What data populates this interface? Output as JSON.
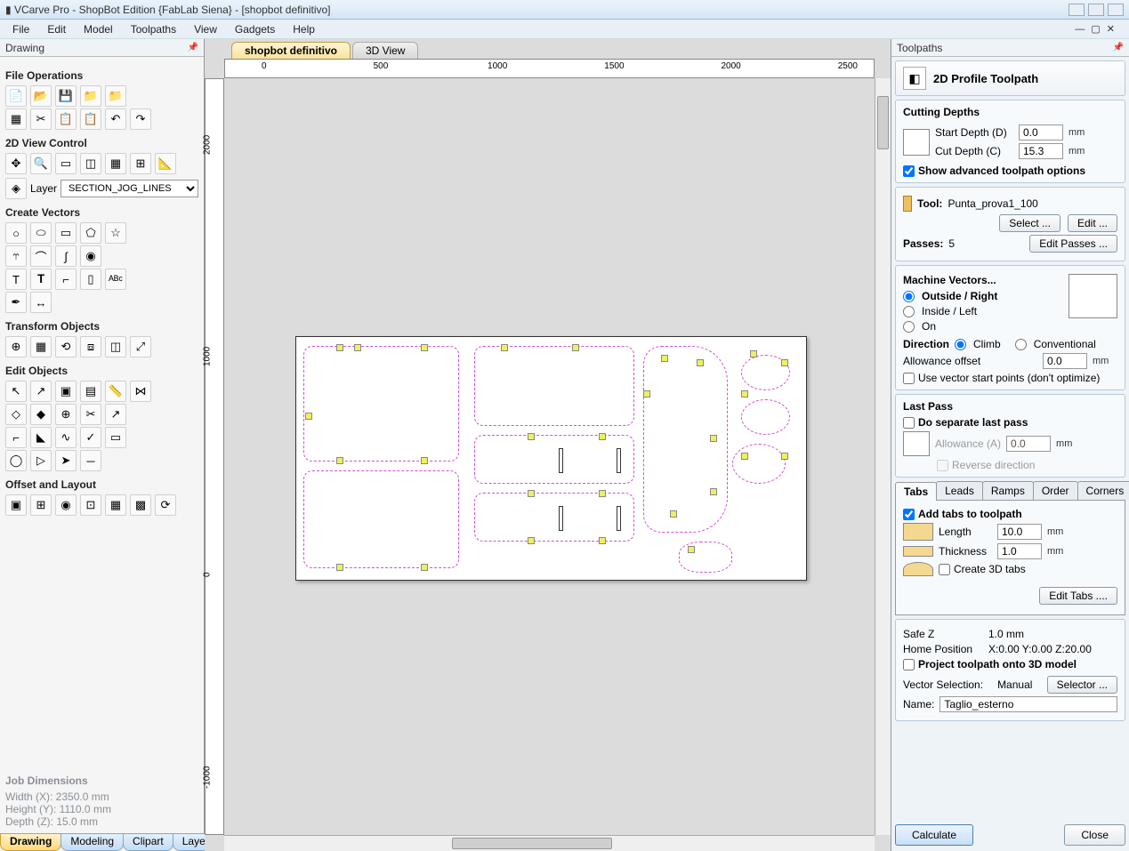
{
  "title": "VCarve Pro - ShopBot Edition {FabLab Siena} - [shopbot definitivo]",
  "menu": [
    "File",
    "Edit",
    "Model",
    "Toolpaths",
    "View",
    "Gadgets",
    "Help"
  ],
  "left_panel": {
    "header": "Drawing",
    "sections": {
      "file_ops": "File Operations",
      "view_ctrl": "2D View Control",
      "layer_label": "Layer",
      "layer_value": "SECTION_JOG_LINES",
      "create_vec": "Create Vectors",
      "transform": "Transform Objects",
      "edit_obj": "Edit Objects",
      "offset": "Offset and Layout"
    },
    "job_title": "Job Dimensions",
    "job_width": "Width  (X): 2350.0 mm",
    "job_height": "Height (Y): 1110.0 mm",
    "job_depth": "Depth  (Z): 15.0 mm",
    "bottom_tabs": [
      "Drawing",
      "Modeling",
      "Clipart",
      "Layers"
    ]
  },
  "center": {
    "tabs": [
      "shopbot definitivo",
      "3D View"
    ],
    "ruler_x": [
      "0",
      "500",
      "1000",
      "1500",
      "2000",
      "2500"
    ],
    "ruler_y": [
      "2000",
      "1000",
      "0",
      "-1000"
    ]
  },
  "right_panel": {
    "header": "Toolpaths",
    "tp_title": "2D Profile Toolpath",
    "cutting_depths": "Cutting Depths",
    "start_depth_label": "Start Depth (D)",
    "start_depth": "0.0",
    "cut_depth_label": "Cut Depth (C)",
    "cut_depth": "15.3",
    "mm": "mm",
    "show_adv": "Show advanced toolpath options",
    "tool_label": "Tool:",
    "tool_name": "Punta_prova1_100",
    "select_btn": "Select ...",
    "edit_btn": "Edit ...",
    "passes_label": "Passes:",
    "passes": "5",
    "edit_passes": "Edit Passes ...",
    "machine_vec": "Machine Vectors...",
    "outside": "Outside / Right",
    "inside": "Inside / Left",
    "on": "On",
    "direction": "Direction",
    "climb": "Climb",
    "conventional": "Conventional",
    "allowance_offset": "Allowance offset",
    "allowance_val": "0.0",
    "use_vec_start": "Use vector start points (don't optimize)",
    "last_pass": "Last Pass",
    "do_sep": "Do separate last pass",
    "allowance_a": "Allowance (A)",
    "allowance_a_val": "0.0",
    "reverse": "Reverse direction",
    "subtabs": [
      "Tabs",
      "Leads",
      "Ramps",
      "Order",
      "Corners"
    ],
    "add_tabs": "Add tabs to toolpath",
    "length_label": "Length",
    "length": "10.0",
    "thick_label": "Thickness",
    "thick": "1.0",
    "create_3d": "Create 3D tabs",
    "edit_tabs": "Edit Tabs ....",
    "safe_z_label": "Safe Z",
    "safe_z": "1.0 mm",
    "home_pos_label": "Home Position",
    "home_pos": "X:0.00 Y:0.00 Z:20.00",
    "project": "Project toolpath onto 3D model",
    "vec_sel_label": "Vector Selection:",
    "vec_sel": "Manual",
    "selector_btn": "Selector ...",
    "name_label": "Name:",
    "name": "Taglio_esterno",
    "calculate": "Calculate",
    "close": "Close"
  }
}
